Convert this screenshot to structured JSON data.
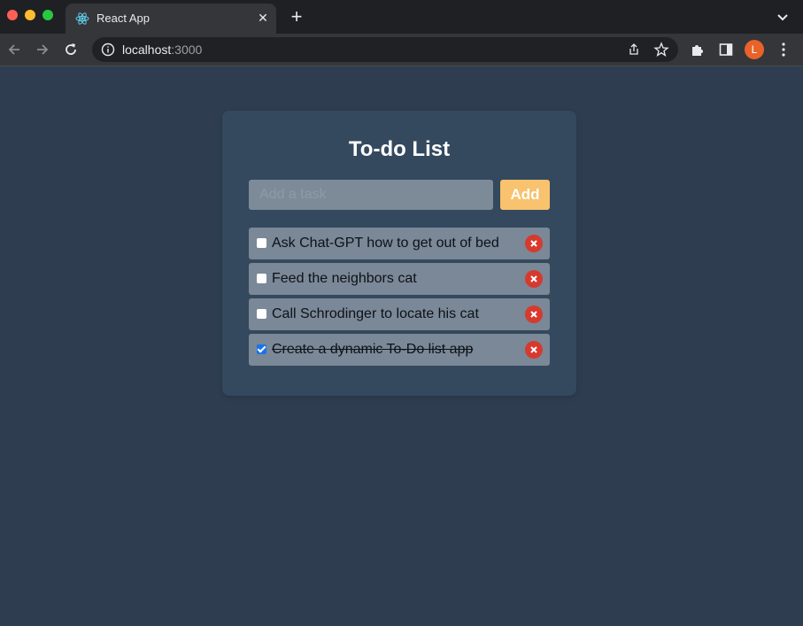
{
  "browser": {
    "tab_title": "React App",
    "url_host": "localhost",
    "url_port": ":3000",
    "profile_initial": "L"
  },
  "app": {
    "title": "To-do List",
    "input_placeholder": "Add a task",
    "input_value": "",
    "add_label": "Add",
    "todos": [
      {
        "text": "Ask Chat-GPT how to get out of bed",
        "completed": false
      },
      {
        "text": "Feed the neighbors cat",
        "completed": false
      },
      {
        "text": "Call Schrodinger to locate his cat",
        "completed": false
      },
      {
        "text": "Create a dynamic To-Do list app",
        "completed": true
      }
    ]
  },
  "colors": {
    "page_bg": "#2e3d50",
    "card_bg": "#34495e",
    "item_bg": "#7a8897",
    "add_button": "#f8c26e",
    "delete_button": "#d63a2f"
  },
  "icons": {
    "favicon": "react-logo-icon",
    "delete": "close-circle-icon"
  }
}
